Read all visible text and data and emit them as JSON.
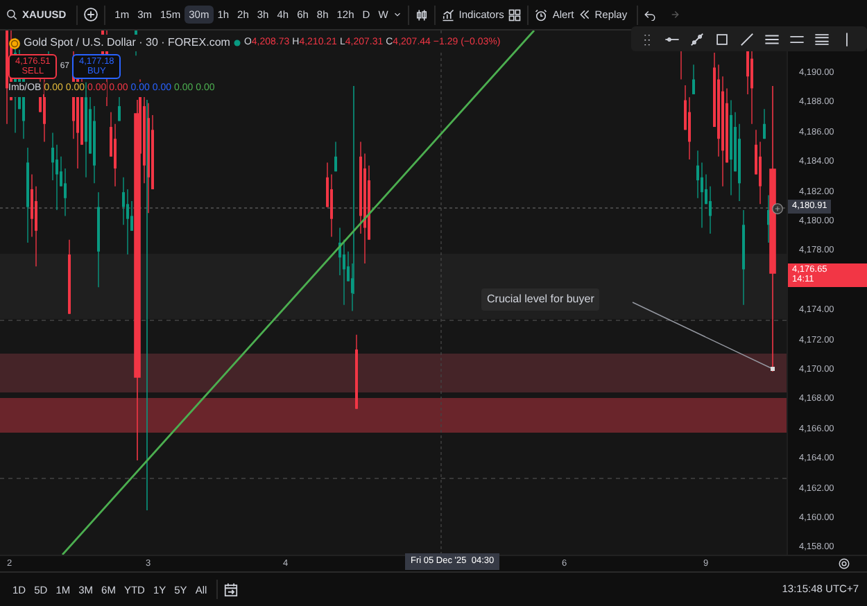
{
  "toolbar": {
    "symbol": "XAUUSD",
    "intervals": [
      {
        "label": "1m",
        "selected": false
      },
      {
        "label": "3m",
        "selected": false
      },
      {
        "label": "15m",
        "selected": false
      },
      {
        "label": "30m",
        "selected": true
      },
      {
        "label": "1h",
        "selected": false
      },
      {
        "label": "2h",
        "selected": false
      },
      {
        "label": "3h",
        "selected": false
      },
      {
        "label": "4h",
        "selected": false
      },
      {
        "label": "6h",
        "selected": false
      },
      {
        "label": "8h",
        "selected": false
      },
      {
        "label": "12h",
        "selected": false
      },
      {
        "label": "D",
        "selected": false
      },
      {
        "label": "W",
        "selected": false
      }
    ],
    "indicators": "Indicators",
    "alert": "Alert",
    "replay": "Replay"
  },
  "legend": {
    "title": "Gold Spot / U.S. Dollar · 30 · FOREX.com",
    "ohlc": [
      {
        "key": "O",
        "value": "4,208.73"
      },
      {
        "key": "H",
        "value": "4,210.21"
      },
      {
        "key": "L",
        "value": "4,207.31"
      },
      {
        "key": "C",
        "value": "4,207.44"
      }
    ],
    "change": "−1.29 (−0.03%)",
    "sell": {
      "price": "4,176.51",
      "label": "SELL"
    },
    "spread": "67",
    "buy": {
      "price": "4,177.18",
      "label": "BUY"
    },
    "indicator": {
      "name": "Imb/OB",
      "values": [
        {
          "text": "0.00",
          "color": "#e2b93b"
        },
        {
          "text": "0.00",
          "color": "#e2b93b"
        },
        {
          "text": "0.00",
          "color": "#f23645"
        },
        {
          "text": "0.00",
          "color": "#f23645"
        },
        {
          "text": "0.00",
          "color": "#2962ff"
        },
        {
          "text": "0.00",
          "color": "#2962ff"
        },
        {
          "text": "0.00",
          "color": "#4caf50"
        },
        {
          "text": "0.00",
          "color": "#4caf50"
        }
      ]
    }
  },
  "price_axis": {
    "ticks": [
      "4,190.00",
      "4,188.00",
      "4,186.00",
      "4,184.00",
      "4,182.00",
      "4,180.00",
      "4,178.00",
      "4,174.00",
      "4,172.00",
      "4,170.00",
      "4,168.00",
      "4,166.00",
      "4,164.00",
      "4,162.00",
      "4,160.00",
      "4,158.00"
    ],
    "crosshair_price": "4,180.91",
    "last_price": "4,176.65",
    "countdown": "14:11"
  },
  "annotation": "Crucial level for buyer",
  "time_axis": {
    "labels": [
      "2",
      "3",
      "4",
      "6",
      "9"
    ],
    "crosshair_date": "Fri 05 Dec '25",
    "crosshair_time": "04:30"
  },
  "bottom_bar": {
    "ranges": [
      "1D",
      "5D",
      "1M",
      "3M",
      "6M",
      "YTD",
      "1Y",
      "5Y",
      "All"
    ],
    "clock": "13:15:48 UTC+7"
  }
}
